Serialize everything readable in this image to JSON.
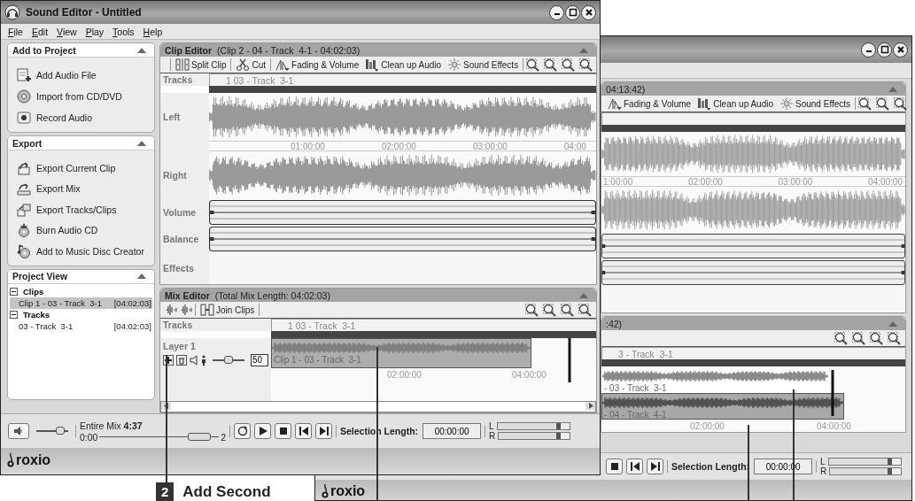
{
  "front_window": {
    "title": "Sound Editor - Untitled",
    "menu": [
      "File",
      "Edit",
      "View",
      "Play",
      "Tools",
      "Help"
    ],
    "panels": [
      {
        "title": "Add to Project",
        "expanded": true,
        "items": [
          "Add Audio File",
          "Import from CD/DVD",
          "Record Audio"
        ]
      },
      {
        "title": "Export",
        "expanded": true,
        "items": [
          "Export Current Clip",
          "Export Mix",
          "Export Tracks/Clips",
          "Burn Audio CD",
          "Add to Music Disc Creator"
        ]
      }
    ],
    "project_view": {
      "title": "Project View",
      "expanded": true,
      "tree": [
        {
          "label": "Clips",
          "expanded": true,
          "children": [
            {
              "label": "Clip 1 - 03 - Track  3-1",
              "duration": "[04:02:03]",
              "selected": true
            }
          ]
        },
        {
          "label": "Tracks",
          "expanded": true,
          "children": [
            {
              "label": "03 - Track  3-1",
              "duration": "[04:02:03]",
              "selected": false
            }
          ]
        }
      ]
    },
    "clip_editor": {
      "title": "Clip Editor",
      "subtitle": "(Clip 2 - 04 - Track  4-1 - 04:02:03)",
      "tools": [
        "Split Clip",
        "Cut",
        "Fading & Volume",
        "Clean up Audio",
        "Sound Effects"
      ],
      "tracks_label": "Tracks",
      "track_name": "1 03 - Track  3-1",
      "rows": [
        "Left",
        "Right",
        "Volume",
        "Balance",
        "Effects"
      ],
      "ticks": [
        "01:00:00",
        "02:00:00",
        "03:00:00",
        "04:00"
      ]
    },
    "mix_editor": {
      "title": "Mix Editor",
      "subtitle": "(Total Mix Length: 04:02:03)",
      "tools": [
        "Join Clips"
      ],
      "tracks_label": "Tracks",
      "track_name": "1 03 - Track  3-1",
      "layers": [
        {
          "name": "Layer 1",
          "level": 0.5,
          "volume": "50",
          "clips": [
            {
              "label": "Clip 1 - 03 - Track  3-1",
              "selected": false
            }
          ]
        }
      ],
      "ticks": [
        "02:00:00",
        "04:00:00"
      ]
    },
    "transport": {
      "volume": {
        "level": 0.75
      },
      "mix_label": "Entire Mix **4:37**",
      "position": {
        "start": "0:00",
        "end": "2",
        "level": 0.93
      },
      "selection_label": "Selection Length:",
      "selection_value": "00:00:00",
      "meters": [
        {
          "label": "L",
          "level": 0.87
        },
        {
          "label": "R",
          "level": 0.87
        }
      ]
    },
    "logo": "roxio"
  },
  "back_window": {
    "clip_editor": {
      "subtitle": "04:13:42)",
      "tools": [
        "Fading & Volume",
        "Clean up Audio",
        "Sound Effects"
      ],
      "ticks": [
        "1:00:00",
        "02:00:00",
        "03:00:00",
        "04:00:00"
      ]
    },
    "mix_editor": {
      "subtitle": ":42)",
      "track_name": "3 - Track  3-1",
      "clips": [
        {
          "label": "- 03 - Track  3-1",
          "selected": false
        },
        {
          "label": "- 04 - Track  4-1",
          "selected": true
        }
      ],
      "ticks": [
        "02:00:00",
        "04:00:00"
      ]
    },
    "transport": {
      "selection_label": "Selection Length:",
      "selection_value": "00:00:00",
      "meters": [
        {
          "label": "L",
          "level": 0.87
        },
        {
          "label": "R",
          "level": 0.87
        }
      ]
    },
    "logo": "roxio"
  },
  "callout": {
    "number": "2",
    "text": "Add Second"
  }
}
